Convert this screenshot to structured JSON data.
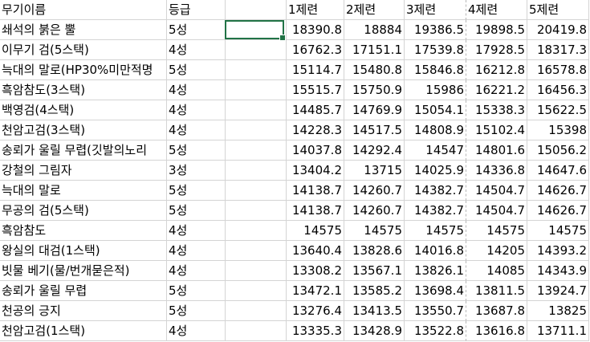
{
  "headers": [
    "무기이름",
    "등급",
    "",
    "1제련",
    "2제련",
    "3제련",
    "4제련",
    "5제련"
  ],
  "rows": [
    {
      "name": "쇄석의 붉은 뿔",
      "grade": "5성",
      "r1": "18390.8",
      "r2": "18884",
      "r3": "19386.5",
      "r4": "19898.5",
      "r5": "20419.8"
    },
    {
      "name": "이무기 검(5스택)",
      "grade": "4성",
      "r1": "16762.3",
      "r2": "17151.1",
      "r3": "17539.8",
      "r4": "17928.5",
      "r5": "18317.3"
    },
    {
      "name": "늑대의 말로(HP30%미만적명",
      "grade": "5성",
      "r1": "15114.7",
      "r2": "15480.8",
      "r3": "15846.8",
      "r4": "16212.8",
      "r5": "16578.8"
    },
    {
      "name": "흑암참도(3스택)",
      "grade": "4성",
      "r1": "15515.7",
      "r2": "15750.9",
      "r3": "15986",
      "r4": "16221.2",
      "r5": "16456.3"
    },
    {
      "name": "백영검(4스택)",
      "grade": "4성",
      "r1": "14485.7",
      "r2": "14769.9",
      "r3": "15054.1",
      "r4": "15338.3",
      "r5": "15622.5"
    },
    {
      "name": "천암고검(3스택)",
      "grade": "4성",
      "r1": "14228.3",
      "r2": "14517.5",
      "r3": "14808.9",
      "r4": "15102.4",
      "r5": "15398"
    },
    {
      "name": "송뢰가 울릴 무렵(깃발의노리",
      "grade": "5성",
      "r1": "14037.8",
      "r2": "14292.4",
      "r3": "14547",
      "r4": "14801.6",
      "r5": "15056.2"
    },
    {
      "name": "강철의 그림자",
      "grade": "3성",
      "r1": "13404.2",
      "r2": "13715",
      "r3": "14025.9",
      "r4": "14336.8",
      "r5": "14647.6"
    },
    {
      "name": "늑대의 말로",
      "grade": "5성",
      "r1": "14138.7",
      "r2": "14260.7",
      "r3": "14382.7",
      "r4": "14504.7",
      "r5": "14626.7"
    },
    {
      "name": "무공의 검(5스택)",
      "grade": "5성",
      "r1": "14138.7",
      "r2": "14260.7",
      "r3": "14382.7",
      "r4": "14504.7",
      "r5": "14626.7"
    },
    {
      "name": "흑암참도",
      "grade": "4성",
      "r1": "14575",
      "r2": "14575",
      "r3": "14575",
      "r4": "14575",
      "r5": "14575"
    },
    {
      "name": "왕실의 대검(1스택)",
      "grade": "4성",
      "r1": "13640.4",
      "r2": "13828.6",
      "r3": "14016.8",
      "r4": "14205",
      "r5": "14393.2"
    },
    {
      "name": "빗물 베기(물/번개묻은적)",
      "grade": "4성",
      "r1": "13308.2",
      "r2": "13567.1",
      "r3": "13826.1",
      "r4": "14085",
      "r5": "14343.9"
    },
    {
      "name": "송뢰가 울릴 무렵",
      "grade": "5성",
      "r1": "13472.1",
      "r2": "13585.2",
      "r3": "13698.4",
      "r4": "13811.5",
      "r5": "13924.7"
    },
    {
      "name": "천공의 긍지",
      "grade": "5성",
      "r1": "13276.4",
      "r2": "13413.5",
      "r3": "13550.7",
      "r4": "13687.8",
      "r5": "13825"
    },
    {
      "name": "천암고검(1스택)",
      "grade": "4성",
      "r1": "13335.3",
      "r2": "13428.9",
      "r3": "13522.8",
      "r4": "13616.8",
      "r5": "13711.1"
    }
  ],
  "colors": {
    "selection": "#217346",
    "gridline": "#d4d4d4"
  }
}
